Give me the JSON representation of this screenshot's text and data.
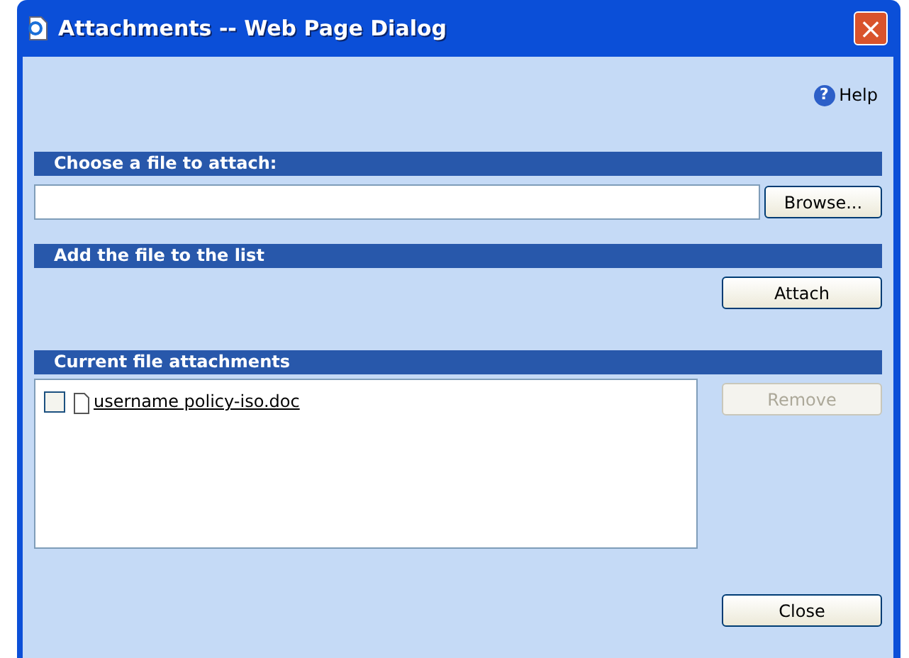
{
  "window": {
    "title": "Attachments -- Web Page Dialog",
    "close": "×"
  },
  "help": {
    "label": "Help",
    "icon": "?"
  },
  "sections": [
    {
      "title": "Choose a file to attach:"
    },
    {
      "title": "Add the file to the list"
    },
    {
      "title": "Current file attachments"
    }
  ],
  "buttons": {
    "browse": {
      "label": "Browse...",
      "disabled": false
    },
    "attach": {
      "label": "Attach",
      "disabled": false
    },
    "remove": {
      "label": "Remove",
      "disabled": true
    },
    "close": {
      "label": "Close",
      "disabled": false
    }
  },
  "attachments": [
    {
      "name": "username policy-iso.doc",
      "checked": false
    }
  ]
}
